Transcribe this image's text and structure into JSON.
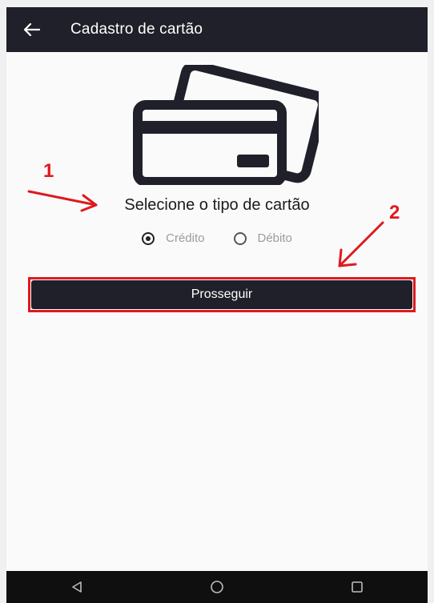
{
  "appbar": {
    "back_icon": "arrow-left-icon",
    "title": "Cadastro de cartão"
  },
  "illustration": {
    "icon": "credit-cards-icon"
  },
  "card_type": {
    "prompt": "Selecione o tipo de cartão",
    "options": [
      {
        "label": "Crédito",
        "selected": true
      },
      {
        "label": "Débito",
        "selected": false
      }
    ]
  },
  "proceed_button": {
    "label": "Prosseguir"
  },
  "annotations": {
    "marker_1": "1",
    "marker_2": "2",
    "color": "#e0191e"
  },
  "navbar": {
    "back_icon": "triangle-back-icon",
    "home_icon": "circle-home-icon",
    "recents_icon": "square-recents-icon"
  },
  "colors": {
    "appbar_bg": "#1f2029",
    "button_bg": "#1f2029",
    "screen_bg": "#fafafa",
    "radio_label": "#9b9b9b"
  }
}
